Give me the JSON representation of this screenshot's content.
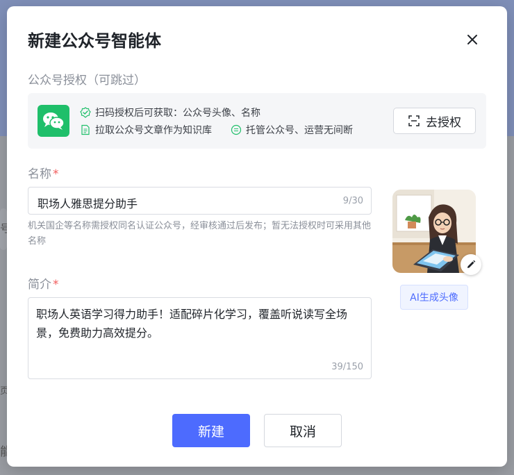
{
  "background": {
    "frag_1": "号",
    "frag_2": "页",
    "frag_3": "能"
  },
  "modal": {
    "title": "新建公众号智能体",
    "close_icon": "close-icon",
    "auth_section": {
      "label": "公众号授权（可跳过）",
      "features": [
        "扫码授权后可获取：公众号头像、名称",
        "拉取公众号文章作为知识库",
        "托管公众号、运营无间断"
      ],
      "auth_button": "去授权"
    },
    "name_field": {
      "label": "名称",
      "required_mark": "*",
      "value": "职场人雅思提分助手",
      "counter": "9/30",
      "hint": "机关国企等名称需授权同名认证公众号，经审核通过后发布；暂无法授权时可采用其他名称"
    },
    "desc_field": {
      "label": "简介",
      "required_mark": "*",
      "value": "职场人英语学习得力助手！适配碎片化学习，覆盖听说读写全场景，免费助力高效提分。",
      "counter": "39/150"
    },
    "avatar": {
      "edit_icon": "pencil-icon",
      "ai_button": "AI生成头像"
    },
    "footer": {
      "create_button": "新建",
      "cancel_button": "取消"
    }
  },
  "colors": {
    "primary": "#4d6bfe",
    "wechat_green": "#1fbf6a",
    "required": "#f25d5d",
    "feature_icon": "#1fbf6a"
  }
}
